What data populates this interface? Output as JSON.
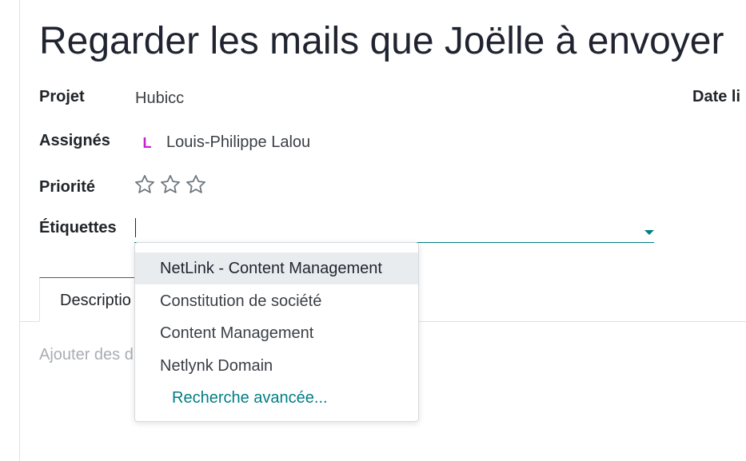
{
  "task": {
    "title": "Regarder les mails que Joëlle à envoyer"
  },
  "fields": {
    "project_label": "Projet",
    "project_value": "Hubicc",
    "date_label": "Date li",
    "assignees_label": "Assignés",
    "assignee_initial": "L",
    "assignee_name": "Louis-Philippe Lalou",
    "priority_label": "Priorité",
    "priority_level": 0,
    "priority_max": 3,
    "tags_label": "Étiquettes",
    "tags_value": ""
  },
  "tabs": {
    "description_label": "Descriptio"
  },
  "editor": {
    "placeholder": "Ajouter des d"
  },
  "tag_dropdown": {
    "options": [
      "NetLink - Content Management",
      "Constitution de société",
      "Content Management",
      "Netlynk Domain"
    ],
    "advanced_search": "Recherche avancée..."
  },
  "colors": {
    "accent": "#017e84",
    "avatar": "#c71fd4",
    "star_outline": "#6c757d"
  }
}
